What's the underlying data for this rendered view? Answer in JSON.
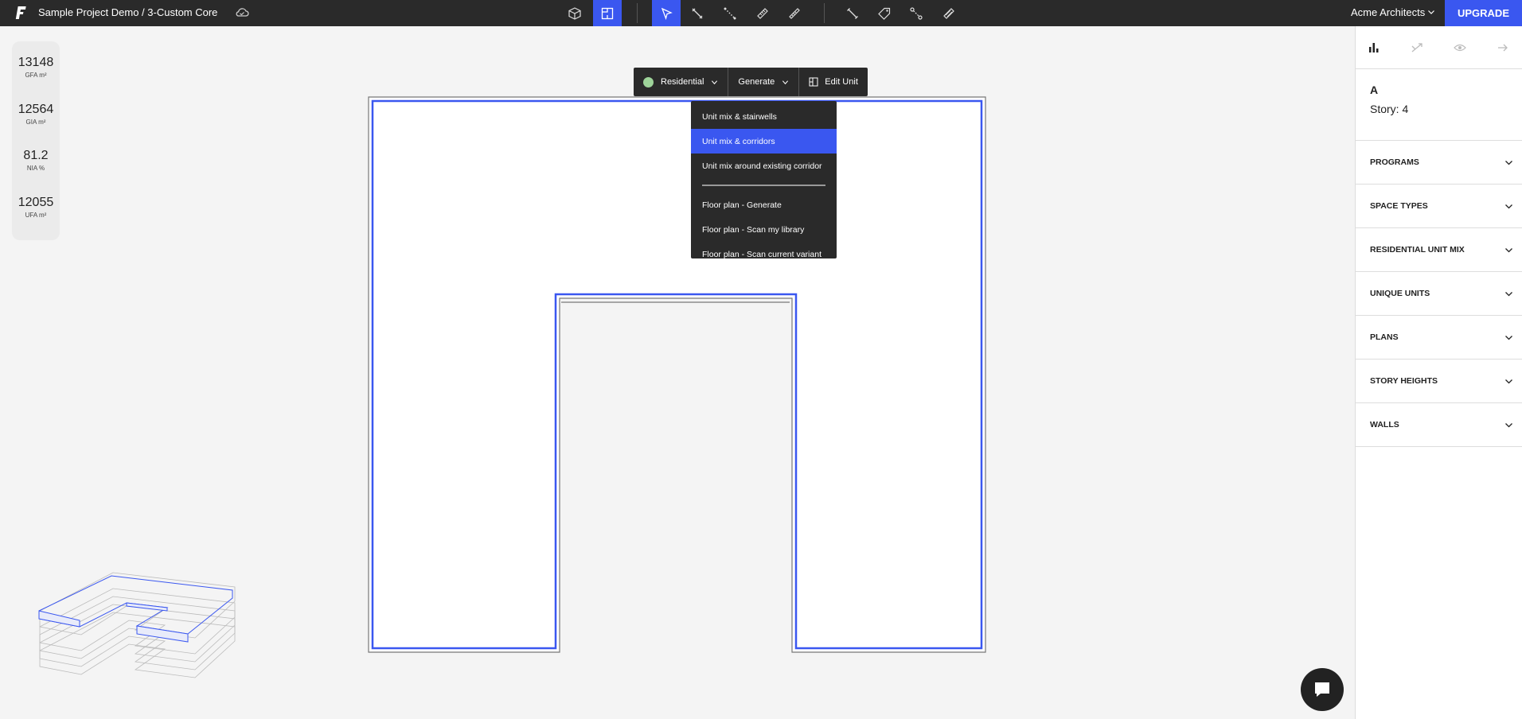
{
  "header": {
    "project_title": "Sample Project Demo / 3-Custom Core",
    "account_name": "Acme Architects",
    "upgrade_label": "UPGRADE"
  },
  "toolbar_icons": [
    "cube-icon",
    "floor-plan-icon",
    "select-arrow-icon",
    "draw-line-icon",
    "dotted-line-icon",
    "ruler-icon",
    "measure-icon",
    "dimension-icon",
    "tag-icon",
    "connect-nodes-icon",
    "hatch-icon"
  ],
  "metrics": [
    {
      "value": "13148",
      "label": "GFA m²"
    },
    {
      "value": "12564",
      "label": "GIA m²"
    },
    {
      "value": "81.2",
      "label": "NIA %"
    },
    {
      "value": "12055",
      "label": "UFA m²"
    }
  ],
  "context_toolbar": {
    "program_label": "Residential",
    "generate_label": "Generate",
    "edit_unit_label": "Edit Unit",
    "program_color": "#9ed49a"
  },
  "generate_menu": {
    "items_top": [
      "Unit mix & stairwells",
      "Unit mix & corridors",
      "Unit mix around existing corridor"
    ],
    "items_bottom": [
      "Floor plan - Generate",
      "Floor plan - Scan my library",
      "Floor plan - Scan current variant"
    ],
    "highlighted": "Unit mix & corridors"
  },
  "panel": {
    "name": "A",
    "story": "Story: 4",
    "sections": [
      "PROGRAMS",
      "SPACE TYPES",
      "RESIDENTIAL UNIT MIX",
      "UNIQUE UNITS",
      "PLANS",
      "STORY HEIGHTS",
      "WALLS"
    ]
  },
  "colors": {
    "accent": "#3a57f0",
    "topbar": "#2a2a2a",
    "outline": "#3a57f0"
  }
}
